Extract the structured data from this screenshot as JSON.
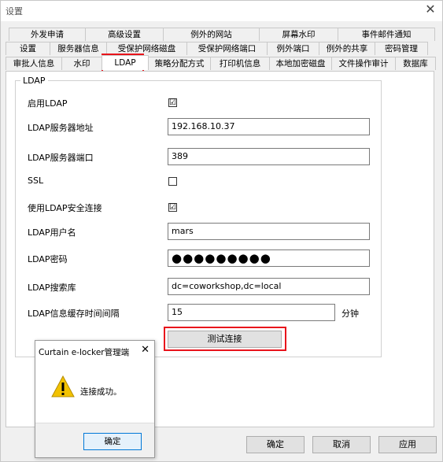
{
  "window": {
    "title": "设置",
    "close_glyph": "✕"
  },
  "tabs": {
    "row1": [
      "外发申请",
      "高级设置",
      "例外的网站",
      "屏幕水印",
      "事件邮件通知"
    ],
    "row2": [
      "设置",
      "服务器信息",
      "受保护网络磁盘",
      "受保护网络端口",
      "例外端口",
      "例外的共享",
      "密码管理"
    ],
    "row3": [
      "审批人信息",
      "水印",
      "LDAP",
      "策略分配方式",
      "打印机信息",
      "本地加密磁盘",
      "文件操作审计",
      "数据库"
    ],
    "active": "LDAP"
  },
  "ldap": {
    "group_title": "LDAP",
    "enable_label": "启用LDAP",
    "enable_checked": true,
    "check_glyph": "☑",
    "address_label": "LDAP服务器地址",
    "address_value": "192.168.10.37",
    "port_label": "LDAP服务器端口",
    "port_value": "389",
    "ssl_label": "SSL",
    "ssl_checked": false,
    "secure_label": "使用LDAP安全连接",
    "secure_checked": true,
    "username_label": "LDAP用户名",
    "username_value": "mars",
    "password_label": "LDAP密码",
    "password_value": "●●●●●●●●●",
    "searchbase_label": "LDAP搜索库",
    "searchbase_value": "dc=coworkshop,dc=local",
    "cache_label": "LDAP信息缓存时间间隔",
    "cache_value": "15",
    "cache_unit": "分钟",
    "test_button": "测试连接"
  },
  "footer": {
    "ok": "确定",
    "cancel": "取消",
    "apply": "应用"
  },
  "popup": {
    "title": "Curtain e-locker管理端",
    "close_glyph": "✕",
    "icon": "warning-icon",
    "message": "连接成功。",
    "ok": "确定"
  },
  "colors": {
    "highlight": "#e8131b",
    "warning": "#f2c200",
    "focus_border": "#0078d7"
  }
}
